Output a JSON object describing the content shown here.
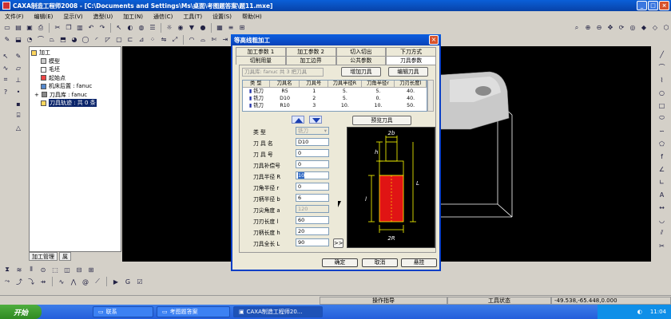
{
  "window": {
    "title": "CAXA制造工程师2008 - [C:\\Documents and Settings\\Ms\\桌面\\考图题答案\\题11.mxe]"
  },
  "menu": [
    "文件(F)",
    "编辑(E)",
    "显示(V)",
    "造型(U)",
    "加工(N)",
    "通信(C)",
    "工具(T)",
    "设置(S)",
    "帮助(H)"
  ],
  "tree": {
    "items": [
      "加工",
      "模型",
      "毛坯",
      "起始点",
      "机床后置 : fanuc",
      "刀具库 : fanuc",
      "刀具轨迹 : 共 0 条"
    ],
    "tabs": [
      "加工管理",
      "属"
    ]
  },
  "dialog": {
    "title": "等高线粗加工",
    "tabs_row1": [
      "加工参数 1",
      "加工参数 2",
      "切入切出",
      "下刀方式"
    ],
    "tabs_row2": [
      "切削用量",
      "加工边界",
      "公共参数",
      "刀具参数"
    ],
    "active_tab": "刀具参数",
    "library_field": "刀具库: fanuc    共 3 把刀具",
    "add_tool": "增加刀具",
    "edit_tool": "编辑刀具",
    "preview_tool": "预览刀具",
    "list_headers": [
      "类 型",
      "刀具名",
      "刀具号",
      "刀具半径R",
      "刀角半径r",
      "刀刃长度l"
    ],
    "tools": [
      [
        "铣刀",
        "R5",
        "1",
        "5.",
        "5.",
        "40."
      ],
      [
        "铣刀",
        "D10",
        "2",
        "5.",
        "0.",
        "40."
      ],
      [
        "铣刀",
        "R10",
        "3",
        "10.",
        "10.",
        "50."
      ]
    ],
    "fields": [
      {
        "label": "类    型",
        "value": "铣刀"
      },
      {
        "label": "刀 具 名",
        "value": "D10"
      },
      {
        "label": "刀 具 号",
        "value": "0"
      },
      {
        "label": "刀具补偿号",
        "value": "0"
      },
      {
        "label": "刀具半径 R",
        "value": "10"
      },
      {
        "label": "刀角半径 r",
        "value": "0"
      },
      {
        "label": "刀柄半径 b",
        "value": "6"
      },
      {
        "label": "刀尖角度 a",
        "value": "120"
      },
      {
        "label": "刀刃长度 l",
        "value": "60"
      },
      {
        "label": "刀柄长度 h",
        "value": "20"
      },
      {
        "label": "刀具全长 L",
        "value": "90"
      }
    ],
    "more_button": ">>",
    "diagram_labels": {
      "shank": "2b",
      "h": "h",
      "l": "l",
      "L": "L",
      "R": "2R"
    },
    "ok": "确定",
    "cancel": "取消",
    "suspend": "悬挂"
  },
  "status": {
    "prompt": "操作指导",
    "tool_state": "工具状态",
    "coords": "-49.538,-65.448,0.000"
  },
  "taskbar": {
    "start": "开始",
    "tasks": [
      "联系",
      "考图题答案",
      "CAXA制造工程师20..."
    ],
    "clock": "11:04"
  },
  "colors": {
    "titlebar": "#0a5fd8",
    "tool_red": "#e01414",
    "tool_outline": "#ffff00",
    "dialog_bg": "#ece9d8"
  }
}
